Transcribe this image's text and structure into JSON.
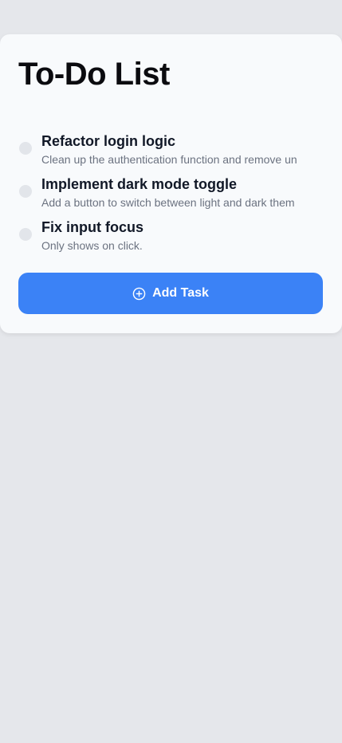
{
  "header": {
    "title": "To-Do List"
  },
  "tasks": [
    {
      "title": "Refactor login logic",
      "description": "Clean up the authentication function and remove un",
      "completed": false
    },
    {
      "title": "Implement dark mode toggle",
      "description": "Add a button to switch between light and dark them",
      "completed": false
    },
    {
      "title": "Fix input focus",
      "description": "Only shows on click.",
      "completed": false
    }
  ],
  "actions": {
    "add_task_label": "Add Task",
    "add_task_icon": "plus-circle-icon"
  },
  "colors": {
    "background": "#e5e7eb",
    "card": "#f8fafc",
    "accent": "#3b82f6",
    "title_text": "#111827",
    "muted_text": "#6b7280",
    "checkbox": "#e2e5ea"
  }
}
